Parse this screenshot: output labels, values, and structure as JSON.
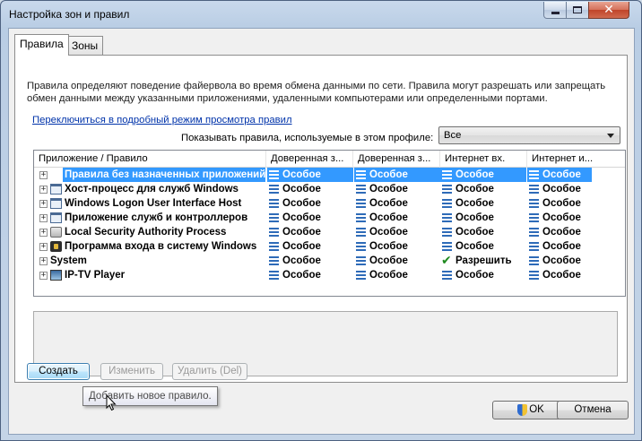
{
  "window": {
    "title": "Настройка зон и правил"
  },
  "tabs": [
    {
      "label": "Правила",
      "active": true
    },
    {
      "label": "Зоны",
      "active": false
    }
  ],
  "rules": {
    "description": "Правила определяют поведение файервола во время обмена данными по сети. Правила могут разрешать или запрещать обмен данными между указанными приложениями, удаленными компьютерами или определенными портами. Дополнительную",
    "detail_link": "Переключиться в подробный режим просмотра правил",
    "profile_label": "Показывать правила, используемые в этом профиле:",
    "profile_value": "Все"
  },
  "table": {
    "columns": [
      "Приложение / Правило",
      "Доверенная з...",
      "Доверенная з...",
      "Интернет вх.",
      "Интернет и..."
    ],
    "rows": [
      {
        "name": "Правила без назначенных приложений",
        "icon": "none",
        "selected": true,
        "values": [
          "Особое",
          "Особое",
          "Особое",
          "Особое"
        ]
      },
      {
        "name": "Хост-процесс для служб Windows",
        "icon": "window-app-icon",
        "selected": false,
        "values": [
          "Особое",
          "Особое",
          "Особое",
          "Особое"
        ]
      },
      {
        "name": "Windows Logon User Interface Host",
        "icon": "window-app-icon",
        "selected": false,
        "values": [
          "Особое",
          "Особое",
          "Особое",
          "Особое"
        ]
      },
      {
        "name": "Приложение служб и контроллеров",
        "icon": "window-app-icon",
        "selected": false,
        "values": [
          "Особое",
          "Особое",
          "Особое",
          "Особое"
        ]
      },
      {
        "name": "Local Security Authority Process",
        "icon": "gear-app-icon",
        "selected": false,
        "values": [
          "Особое",
          "Особое",
          "Особое",
          "Особое"
        ]
      },
      {
        "name": "Программа входа в систему Windows",
        "icon": "lock-app-icon",
        "selected": false,
        "values": [
          "Особое",
          "Особое",
          "Особое",
          "Особое"
        ]
      },
      {
        "name": "System",
        "icon": "none",
        "selected": false,
        "values": [
          "Особое",
          "Особое",
          "Разрешить",
          "Особое"
        ]
      },
      {
        "name": "IP-TV Player",
        "icon": "tv-app-icon",
        "selected": false,
        "values": [
          "Особое",
          "Особое",
          "Особое",
          "Особое"
        ]
      }
    ]
  },
  "buttons": {
    "create": "Создать",
    "edit": "Изменить",
    "delete": "Удалить (Del)",
    "ok": "OK",
    "cancel": "Отмена"
  },
  "tooltip": "Добавить новое правило.",
  "icons": {
    "custom_value": "custom-rule-icon",
    "allow_value": "checkmark-icon"
  }
}
